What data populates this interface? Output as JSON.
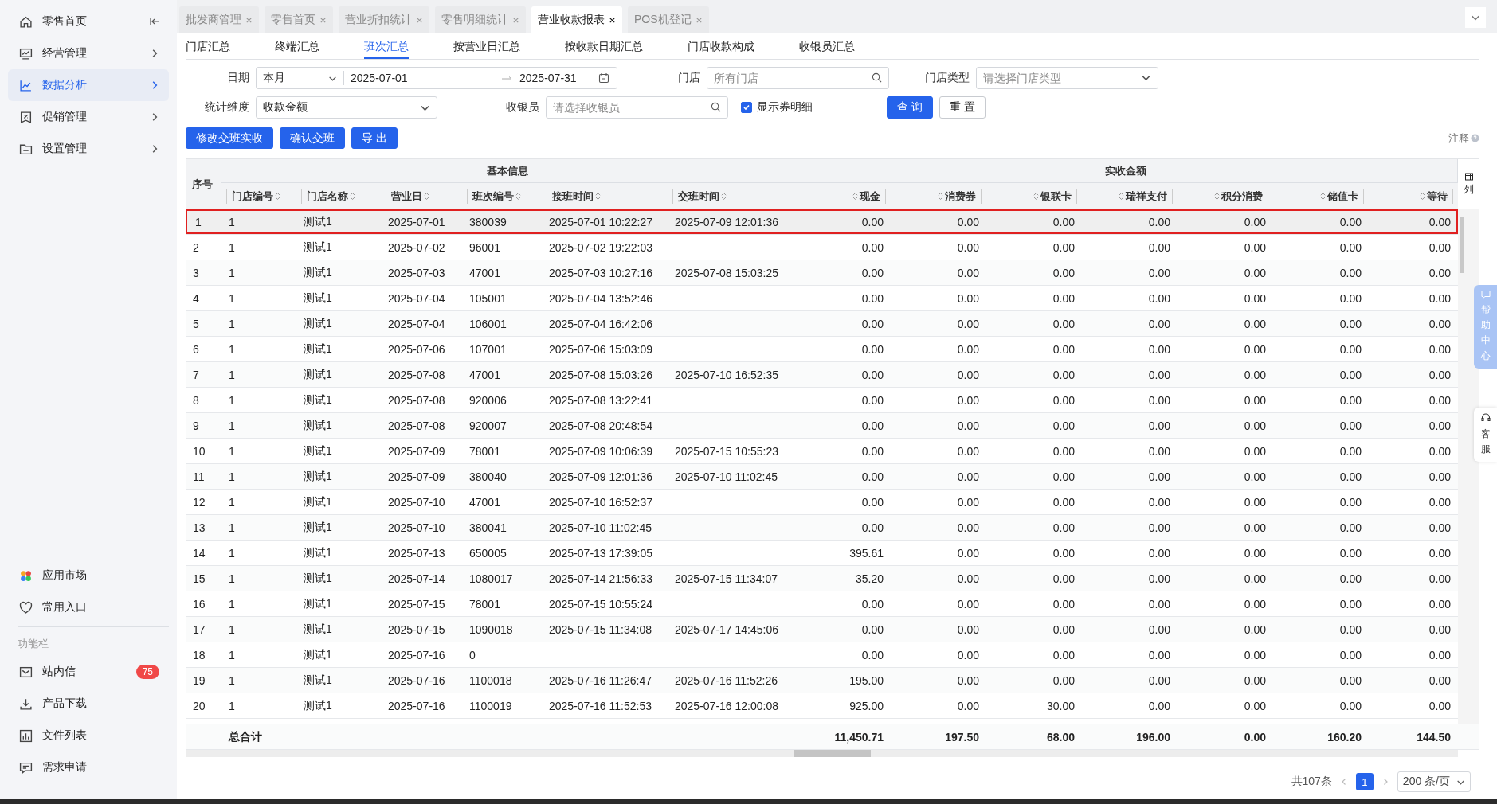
{
  "sidebar": {
    "items": [
      {
        "label": "零售首页",
        "kind": "home",
        "selected": false
      },
      {
        "label": "经营管理",
        "kind": "submenu",
        "selected": false
      },
      {
        "label": "数据分析",
        "kind": "submenu",
        "selected": true
      },
      {
        "label": "促销管理",
        "kind": "submenu",
        "selected": false
      },
      {
        "label": "设置管理",
        "kind": "submenu",
        "selected": false
      }
    ],
    "bottom_items": [
      {
        "label": "应用市场"
      },
      {
        "label": "常用入口"
      }
    ],
    "section_label": "功能栏",
    "tool_items": [
      {
        "label": "站内信",
        "badge": "75"
      },
      {
        "label": "产品下载"
      },
      {
        "label": "文件列表"
      },
      {
        "label": "需求申请"
      }
    ]
  },
  "tabs": [
    {
      "label": "批发商管理",
      "selected": false
    },
    {
      "label": "零售首页",
      "selected": false
    },
    {
      "label": "营业折扣统计",
      "selected": false
    },
    {
      "label": "零售明细统计",
      "selected": false
    },
    {
      "label": "营业收款报表",
      "selected": true
    },
    {
      "label": "POS机登记",
      "selected": false
    }
  ],
  "sub_tabs": [
    {
      "label": "门店汇总",
      "selected": false
    },
    {
      "label": "终端汇总",
      "selected": false
    },
    {
      "label": "班次汇总",
      "selected": true
    },
    {
      "label": "按营业日汇总",
      "selected": false
    },
    {
      "label": "按收款日期汇总",
      "selected": false
    },
    {
      "label": "门店收款构成",
      "selected": false
    },
    {
      "label": "收银员汇总",
      "selected": false
    }
  ],
  "filters": {
    "date_label": "日期",
    "date_preset": "本月",
    "date_start": "2025-07-01",
    "date_end": "2025-07-31",
    "store_label": "门店",
    "store_placeholder": "所有门店",
    "store_type_label": "门店类型",
    "store_type_placeholder": "请选择门店类型",
    "dimension_label": "统计维度",
    "dimension_value": "收款金额",
    "cashier_label": "收银员",
    "cashier_placeholder": "请选择收银员",
    "show_coupon_detail": {
      "label": "显示券明细",
      "checked": true
    },
    "query_button": "查 询",
    "reset_button": "重 置"
  },
  "actions": [
    "修改交班实收",
    "确认交班",
    "导 出"
  ],
  "note": "注释",
  "table": {
    "index_header": "序号",
    "groups": [
      {
        "label": "基本信息",
        "columns": [
          "门店编号",
          "门店名称",
          "营业日",
          "班次编号",
          "接班时间",
          "交班时间"
        ]
      },
      {
        "label": "实收金额",
        "columns": [
          "现金",
          "消费券",
          "银联卡",
          "瑞祥支付",
          "积分消费",
          "储值卡",
          "等待"
        ]
      }
    ],
    "column_settings": "列",
    "rows": [
      {
        "selected": true,
        "cells": [
          "1",
          "1",
          "测试1",
          "2025-07-01",
          "380039",
          "2025-07-01 10:22:27",
          "2025-07-09 12:01:36",
          "0.00",
          "0.00",
          "0.00",
          "0.00",
          "0.00",
          "0.00",
          "0.00"
        ]
      },
      {
        "selected": false,
        "cells": [
          "2",
          "1",
          "测试1",
          "2025-07-02",
          "96001",
          "2025-07-02 19:22:03",
          "",
          "0.00",
          "0.00",
          "0.00",
          "0.00",
          "0.00",
          "0.00",
          "0.00"
        ]
      },
      {
        "selected": false,
        "cells": [
          "3",
          "1",
          "测试1",
          "2025-07-03",
          "47001",
          "2025-07-03 10:27:16",
          "2025-07-08 15:03:25",
          "0.00",
          "0.00",
          "0.00",
          "0.00",
          "0.00",
          "0.00",
          "0.00"
        ]
      },
      {
        "selected": false,
        "cells": [
          "4",
          "1",
          "测试1",
          "2025-07-04",
          "105001",
          "2025-07-04 13:52:46",
          "",
          "0.00",
          "0.00",
          "0.00",
          "0.00",
          "0.00",
          "0.00",
          "0.00"
        ]
      },
      {
        "selected": false,
        "cells": [
          "5",
          "1",
          "测试1",
          "2025-07-04",
          "106001",
          "2025-07-04 16:42:06",
          "",
          "0.00",
          "0.00",
          "0.00",
          "0.00",
          "0.00",
          "0.00",
          "0.00"
        ]
      },
      {
        "selected": false,
        "cells": [
          "6",
          "1",
          "测试1",
          "2025-07-06",
          "107001",
          "2025-07-06 15:03:09",
          "",
          "0.00",
          "0.00",
          "0.00",
          "0.00",
          "0.00",
          "0.00",
          "0.00"
        ]
      },
      {
        "selected": false,
        "cells": [
          "7",
          "1",
          "测试1",
          "2025-07-08",
          "47001",
          "2025-07-08 15:03:26",
          "2025-07-10 16:52:35",
          "0.00",
          "0.00",
          "0.00",
          "0.00",
          "0.00",
          "0.00",
          "0.00"
        ]
      },
      {
        "selected": false,
        "cells": [
          "8",
          "1",
          "测试1",
          "2025-07-08",
          "920006",
          "2025-07-08 13:22:41",
          "",
          "0.00",
          "0.00",
          "0.00",
          "0.00",
          "0.00",
          "0.00",
          "0.00"
        ]
      },
      {
        "selected": false,
        "cells": [
          "9",
          "1",
          "测试1",
          "2025-07-08",
          "920007",
          "2025-07-08 20:48:54",
          "",
          "0.00",
          "0.00",
          "0.00",
          "0.00",
          "0.00",
          "0.00",
          "0.00"
        ]
      },
      {
        "selected": false,
        "cells": [
          "10",
          "1",
          "测试1",
          "2025-07-09",
          "78001",
          "2025-07-09 10:06:39",
          "2025-07-15 10:55:23",
          "0.00",
          "0.00",
          "0.00",
          "0.00",
          "0.00",
          "0.00",
          "0.00"
        ]
      },
      {
        "selected": false,
        "cells": [
          "11",
          "1",
          "测试1",
          "2025-07-09",
          "380040",
          "2025-07-09 12:01:36",
          "2025-07-10 11:02:45",
          "0.00",
          "0.00",
          "0.00",
          "0.00",
          "0.00",
          "0.00",
          "0.00"
        ]
      },
      {
        "selected": false,
        "cells": [
          "12",
          "1",
          "测试1",
          "2025-07-10",
          "47001",
          "2025-07-10 16:52:37",
          "",
          "0.00",
          "0.00",
          "0.00",
          "0.00",
          "0.00",
          "0.00",
          "0.00"
        ]
      },
      {
        "selected": false,
        "cells": [
          "13",
          "1",
          "测试1",
          "2025-07-10",
          "380041",
          "2025-07-10 11:02:45",
          "",
          "0.00",
          "0.00",
          "0.00",
          "0.00",
          "0.00",
          "0.00",
          "0.00"
        ]
      },
      {
        "selected": false,
        "cells": [
          "14",
          "1",
          "测试1",
          "2025-07-13",
          "650005",
          "2025-07-13 17:39:05",
          "",
          "395.61",
          "0.00",
          "0.00",
          "0.00",
          "0.00",
          "0.00",
          "0.00"
        ]
      },
      {
        "selected": false,
        "cells": [
          "15",
          "1",
          "测试1",
          "2025-07-14",
          "1080017",
          "2025-07-14 21:56:33",
          "2025-07-15 11:34:07",
          "35.20",
          "0.00",
          "0.00",
          "0.00",
          "0.00",
          "0.00",
          "0.00"
        ]
      },
      {
        "selected": false,
        "cells": [
          "16",
          "1",
          "测试1",
          "2025-07-15",
          "78001",
          "2025-07-15 10:55:24",
          "",
          "0.00",
          "0.00",
          "0.00",
          "0.00",
          "0.00",
          "0.00",
          "0.00"
        ]
      },
      {
        "selected": false,
        "cells": [
          "17",
          "1",
          "测试1",
          "2025-07-15",
          "1090018",
          "2025-07-15 11:34:08",
          "2025-07-17 14:45:06",
          "0.00",
          "0.00",
          "0.00",
          "0.00",
          "0.00",
          "0.00",
          "0.00"
        ]
      },
      {
        "selected": false,
        "cells": [
          "18",
          "1",
          "测试1",
          "2025-07-16",
          "0",
          "",
          "",
          "0.00",
          "0.00",
          "0.00",
          "0.00",
          "0.00",
          "0.00",
          "0.00"
        ]
      },
      {
        "selected": false,
        "cells": [
          "19",
          "1",
          "测试1",
          "2025-07-16",
          "1100018",
          "2025-07-16 11:26:47",
          "2025-07-16 11:52:26",
          "195.00",
          "0.00",
          "0.00",
          "0.00",
          "0.00",
          "0.00",
          "0.00"
        ]
      },
      {
        "selected": false,
        "cells": [
          "20",
          "1",
          "测试1",
          "2025-07-16",
          "1100019",
          "2025-07-16 11:52:53",
          "2025-07-16 12:00:08",
          "925.00",
          "0.00",
          "30.00",
          "0.00",
          "0.00",
          "0.00",
          "0.00"
        ]
      }
    ],
    "total_label": "总合计",
    "totals": [
      "11,450.71",
      "197.50",
      "68.00",
      "196.00",
      "0.00",
      "160.20",
      "144.50"
    ]
  },
  "pagination": {
    "total": "共107条",
    "pages": [
      {
        "label": "1",
        "selected": true
      }
    ],
    "page_size": "200 条/页"
  },
  "float_panel": {
    "help": "帮助中心",
    "service": "客服"
  }
}
